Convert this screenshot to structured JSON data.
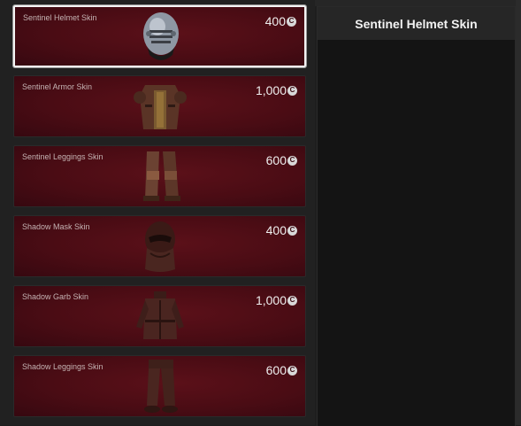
{
  "shop": {
    "selected_index": 0,
    "items": [
      {
        "name": "Sentinel Helmet Skin",
        "price": "400",
        "icon": "sentinel-helmet-icon"
      },
      {
        "name": "Sentinel Armor Skin",
        "price": "1,000",
        "icon": "sentinel-armor-icon"
      },
      {
        "name": "Sentinel Leggings Skin",
        "price": "600",
        "icon": "sentinel-leggings-icon"
      },
      {
        "name": "Shadow Mask Skin",
        "price": "400",
        "icon": "shadow-mask-icon"
      },
      {
        "name": "Shadow Garb Skin",
        "price": "1,000",
        "icon": "shadow-garb-icon"
      },
      {
        "name": "Shadow Leggings Skin",
        "price": "600",
        "icon": "shadow-leggings-icon"
      }
    ],
    "currency_symbol": "C"
  },
  "detail": {
    "title": "Sentinel Helmet Skin"
  },
  "colors": {
    "card_bg": "#4a0c14",
    "panel_bg": "#141414",
    "selected_border": "#f3f3f3"
  }
}
